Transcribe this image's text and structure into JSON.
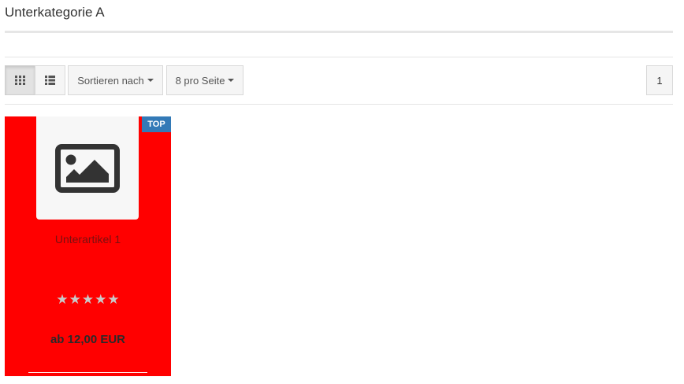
{
  "category": {
    "title": "Unterkategorie A"
  },
  "toolbar": {
    "view_grid_icon": "grid-icon",
    "view_list_icon": "list-icon",
    "sort_label": "Sortieren nach",
    "per_page_label": "8 pro Seite",
    "current_page": "1"
  },
  "product": {
    "badge": "TOP",
    "image_icon": "image-placeholder-icon",
    "name": "Unterartikel 1",
    "stars": [
      "★",
      "★",
      "★",
      "★",
      "★"
    ],
    "price": "ab 12,00 EUR"
  },
  "colors": {
    "card_background": "#ff0000",
    "badge_background": "#337ab7"
  }
}
